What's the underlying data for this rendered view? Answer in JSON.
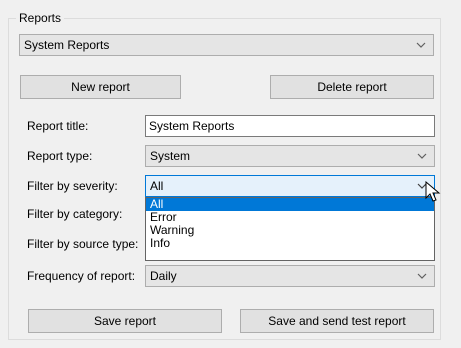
{
  "group_title": "Reports",
  "report_selector": {
    "value": "System Reports"
  },
  "buttons": {
    "new_report": "New report",
    "delete_report": "Delete report",
    "save_report": "Save report",
    "save_send_test": "Save and send test report"
  },
  "fields": {
    "report_title": {
      "label": "Report title:",
      "value": "System Reports"
    },
    "report_type": {
      "label": "Report type:",
      "value": "System"
    },
    "filter_severity": {
      "label": "Filter by severity:",
      "value": "All"
    },
    "filter_category": {
      "label": "Filter by category:"
    },
    "filter_source": {
      "label": "Filter by source type:"
    },
    "frequency": {
      "label": "Frequency of report:",
      "value": "Daily"
    }
  },
  "severity_options": [
    "All",
    "Error",
    "Warning",
    "Info"
  ],
  "selected_option_index": 0,
  "icons": {
    "dropdown": "chevron-down-icon",
    "cursor": "mouse-pointer-icon"
  },
  "colors": {
    "selection": "#0078d7",
    "focus_border": "#0078d7"
  }
}
